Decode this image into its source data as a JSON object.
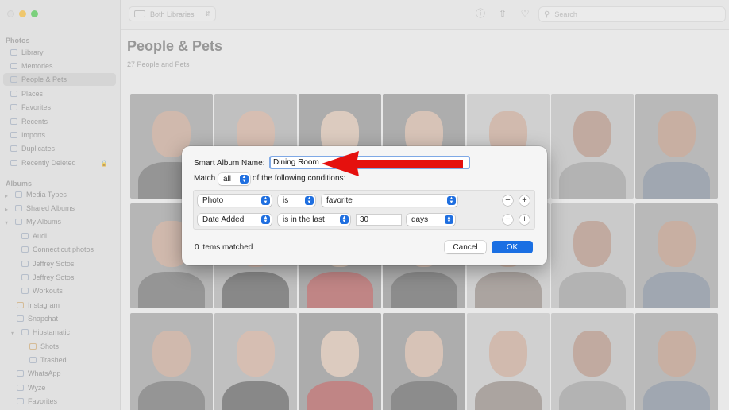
{
  "colors": {
    "accent": "#1a6fe3",
    "arrow": "#e5100e",
    "traffic_red": "#d9d9d9",
    "traffic_yellow": "#f2b42a",
    "traffic_green": "#3fc241"
  },
  "sidebar": {
    "photos_header": "Photos",
    "photos_items": [
      {
        "label": "Library",
        "icon": "library-icon"
      },
      {
        "label": "Memories",
        "icon": "memories-icon"
      },
      {
        "label": "People & Pets",
        "icon": "people-icon",
        "active": true
      },
      {
        "label": "Places",
        "icon": "places-icon"
      },
      {
        "label": "Favorites",
        "icon": "heart-icon"
      },
      {
        "label": "Recents",
        "icon": "clock-icon"
      },
      {
        "label": "Imports",
        "icon": "import-icon"
      },
      {
        "label": "Duplicates",
        "icon": "duplicate-icon"
      },
      {
        "label": "Recently Deleted",
        "icon": "trash-icon"
      }
    ],
    "albums_header": "Albums",
    "album_items": [
      {
        "label": "Media Types"
      },
      {
        "label": "Shared Albums"
      },
      {
        "label": "My Albums"
      },
      {
        "label": "Audi"
      },
      {
        "label": "Connecticut photos"
      },
      {
        "label": "Jeffrey Sotos"
      },
      {
        "label": "Jeffrey Sotos"
      },
      {
        "label": "Workouts"
      },
      {
        "label": "Instagram"
      },
      {
        "label": "Snapchat"
      },
      {
        "label": "Hipstamatic"
      },
      {
        "label": "Shots"
      },
      {
        "label": "Trashed"
      },
      {
        "label": "WhatsApp"
      },
      {
        "label": "Wyze"
      },
      {
        "label": "Favorites"
      }
    ]
  },
  "toolbar": {
    "library_select": "Both Libraries",
    "search_placeholder": "Search"
  },
  "main": {
    "title": "People & Pets",
    "subtitle": "27 People and Pets"
  },
  "dialog": {
    "name_label": "Smart Album Name:",
    "name_value": "Dining Room",
    "match_label": "Match",
    "match_value": "all",
    "match_suffix": "of the following conditions:",
    "conditions": [
      {
        "field": "Photo",
        "operator": "is",
        "value": "favorite"
      },
      {
        "field": "Date Added",
        "operator": "is in the last",
        "number": "30",
        "unit": "days"
      }
    ],
    "matched_text": "0 items matched",
    "cancel_label": "Cancel",
    "ok_label": "OK"
  }
}
